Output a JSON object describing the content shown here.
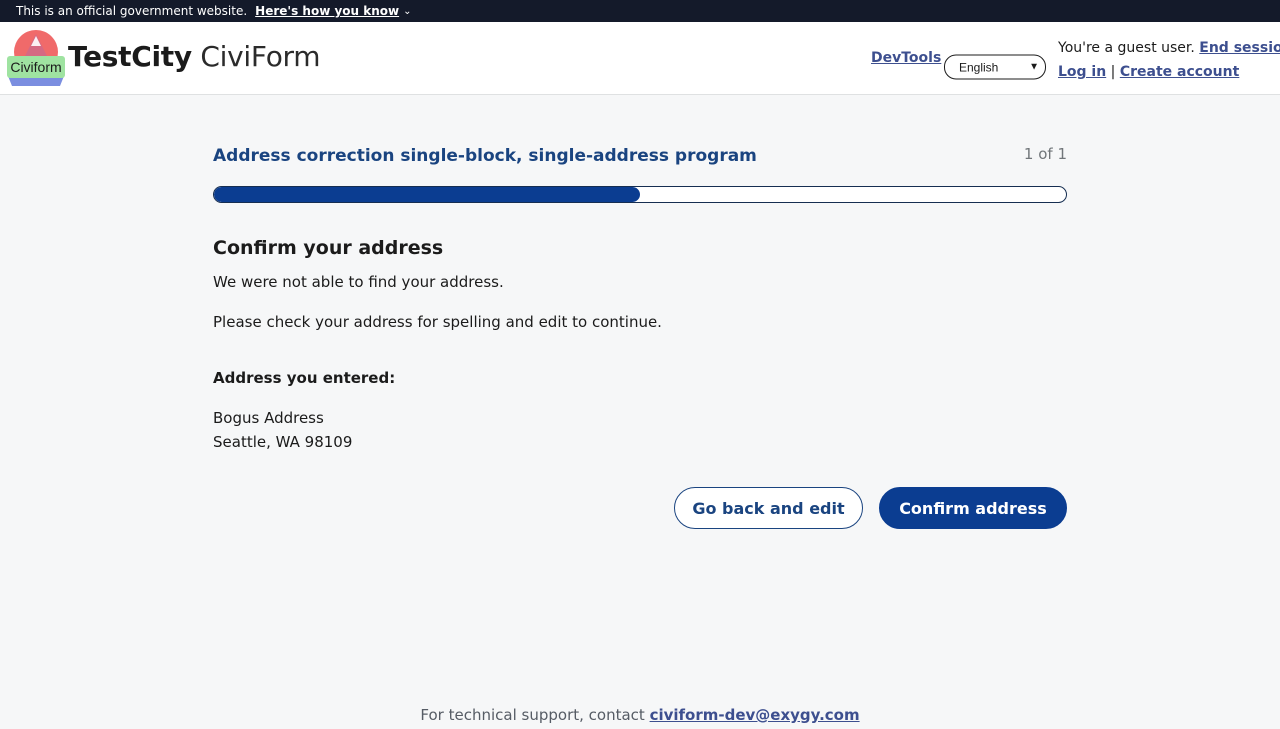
{
  "gov_banner": {
    "text": "This is an official government website.",
    "how_link": "Here's how you know",
    "chevron_icon": "chevron-down-icon"
  },
  "header": {
    "logo_text": "Civiform",
    "brand_city": "TestCity",
    "brand_product": "CiviForm",
    "devtools_label": "DevTools",
    "language_selected": "English",
    "guest_text": "You're a guest user.",
    "end_session_label": "End session",
    "login_label": "Log in",
    "separator": "|",
    "create_account_label": "Create account"
  },
  "main": {
    "program_title": "Address correction single-block, single-address program",
    "step_count": "1 of 1",
    "progress_fraction": 0.5,
    "heading": "Confirm your address",
    "message_1": "We were not able to find your address.",
    "message_2": "Please check your address for spelling and edit to continue.",
    "entered_label": "Address you entered:",
    "address_line_1": "Bogus Address",
    "address_line_2": "Seattle, WA 98109",
    "back_button_label": "Go back and edit",
    "confirm_button_label": "Confirm address"
  },
  "footer": {
    "support_text": "For technical support, contact",
    "support_email": "civiform-dev@exygy.com"
  },
  "colors": {
    "primary": "#0b3d91",
    "link": "#3d4f8f",
    "banner_bg": "#141a2a"
  }
}
